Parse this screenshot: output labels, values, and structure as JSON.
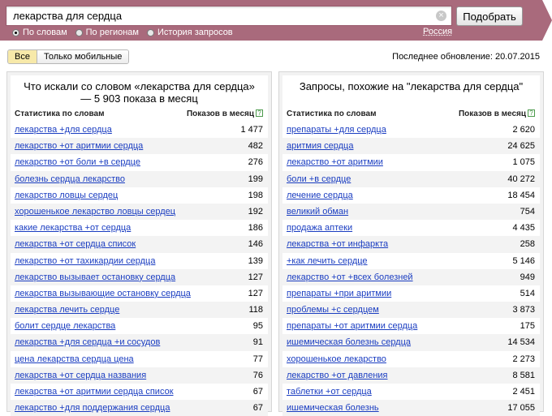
{
  "search": {
    "query": "лекарства для сердца",
    "submit_label": "Подобрать",
    "clear_symbol": "×"
  },
  "modes": [
    {
      "label": "По словам",
      "checked": true
    },
    {
      "label": "По регионам",
      "checked": false
    },
    {
      "label": "История запросов",
      "checked": false
    }
  ],
  "region": "Россия",
  "filters": [
    "Все",
    "Только мобильные"
  ],
  "last_update": "Последнее обновление: 20.07.2015",
  "colors": {
    "header": "#a96a7c",
    "link": "#1a3dc1",
    "active_filter": "#f7e9a9"
  },
  "left_panel": {
    "title": "Что искали со словом «лекарства для сердца» — 5 903 показа в месяц",
    "col1": "Статистика по словам",
    "col2": "Показов в месяц",
    "help_icon": "?",
    "rows": [
      {
        "q": "лекарства +для сердца",
        "n": "1 477"
      },
      {
        "q": "лекарство +от аритмии сердца",
        "n": "482"
      },
      {
        "q": "лекарство +от боли +в сердце",
        "n": "276"
      },
      {
        "q": "болезнь сердца лекарство",
        "n": "199"
      },
      {
        "q": "лекарство ловцы сердец",
        "n": "198"
      },
      {
        "q": "хорошенькое лекарство ловцы сердец",
        "n": "192"
      },
      {
        "q": "какие лекарства +от сердца",
        "n": "186"
      },
      {
        "q": "лекарства +от сердца список",
        "n": "146"
      },
      {
        "q": "лекарство +от тахикардии сердца",
        "n": "139"
      },
      {
        "q": "лекарство вызывает остановку сердца",
        "n": "127"
      },
      {
        "q": "лекарства вызывающие остановку сердца",
        "n": "127"
      },
      {
        "q": "лекарства лечить сердце",
        "n": "118"
      },
      {
        "q": "болит сердце лекарства",
        "n": "95"
      },
      {
        "q": "лекарства +для сердца +и сосудов",
        "n": "91"
      },
      {
        "q": "цена лекарства сердца цена",
        "n": "77"
      },
      {
        "q": "лекарства +от сердца названия",
        "n": "76"
      },
      {
        "q": "лекарства +от аритмии сердца список",
        "n": "67"
      },
      {
        "q": "лекарство +для поддержания сердца",
        "n": "67"
      }
    ]
  },
  "right_panel": {
    "title": "Запросы, похожие на \"лекарства для сердца\"",
    "col1": "Статистика по словам",
    "col2": "Показов в месяц",
    "help_icon": "?",
    "rows": [
      {
        "q": "препараты +для сердца",
        "n": "2 620"
      },
      {
        "q": "аритмия сердца",
        "n": "24 625"
      },
      {
        "q": "лекарство +от аритмии",
        "n": "1 075"
      },
      {
        "q": "боли +в сердце",
        "n": "40 272"
      },
      {
        "q": "лечение сердца",
        "n": "18 454"
      },
      {
        "q": "великий обман",
        "n": "754"
      },
      {
        "q": "продажа аптеки",
        "n": "4 435"
      },
      {
        "q": "лекарства +от инфаркта",
        "n": "258"
      },
      {
        "q": "+как лечить сердце",
        "n": "5 146"
      },
      {
        "q": "лекарство +от +всех болезней",
        "n": "949"
      },
      {
        "q": "препараты +при аритмии",
        "n": "514"
      },
      {
        "q": "проблемы +с сердцем",
        "n": "3 873"
      },
      {
        "q": "препараты +от аритмии сердца",
        "n": "175"
      },
      {
        "q": "ишемическая болезнь сердца",
        "n": "14 534"
      },
      {
        "q": "хорошенькое лекарство",
        "n": "2 273"
      },
      {
        "q": "лекарство +от давления",
        "n": "8 581"
      },
      {
        "q": "таблетки +от сердца",
        "n": "2 451"
      },
      {
        "q": "ишемическая болезнь",
        "n": "17 055"
      }
    ]
  }
}
